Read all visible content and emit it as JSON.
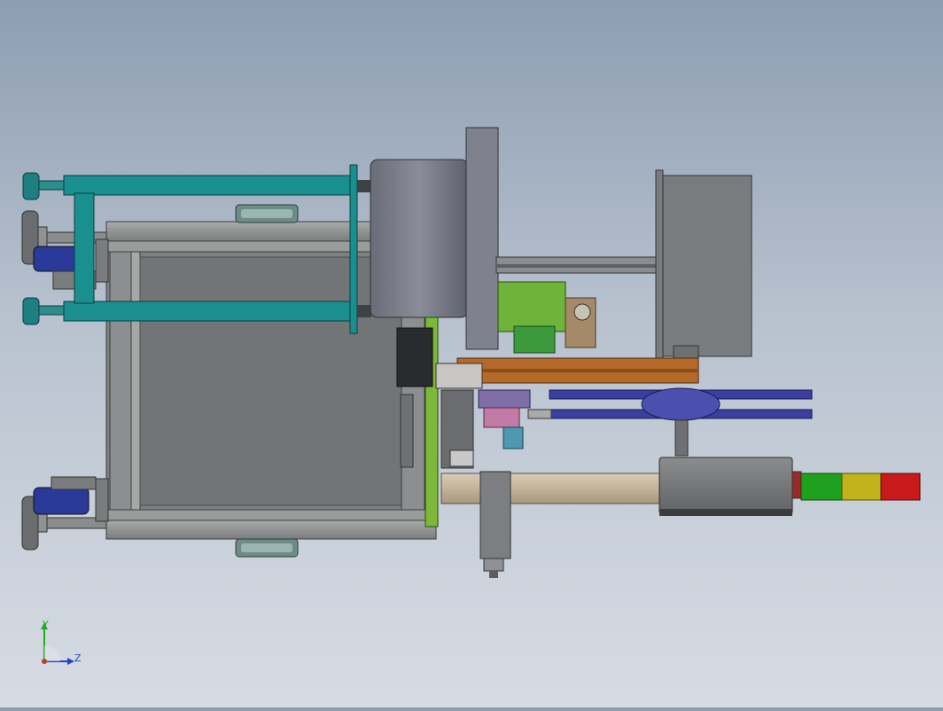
{
  "viewport": {
    "background_top": "#8d9db2",
    "background_bottom": "#d7dce3"
  },
  "model_colors": {
    "frame_gray": "#8f9190",
    "frame_dark": "#5b5d5e",
    "teal_bracket": "#1a8f8f",
    "blue_motor": "#2a3a9a",
    "green_plate": "#6fb43a",
    "wood_rail": "#b56a2a",
    "belt_blue": "#3b3fa0",
    "tube_tan": "#c9b9a4",
    "light_green": "#1fa01f",
    "light_yellow": "#c2b21c",
    "light_red": "#c81a1a"
  },
  "triad": {
    "y_label": "Y",
    "z_label": "Z",
    "y_color": "#22aa22",
    "z_color": "#2244cc"
  }
}
